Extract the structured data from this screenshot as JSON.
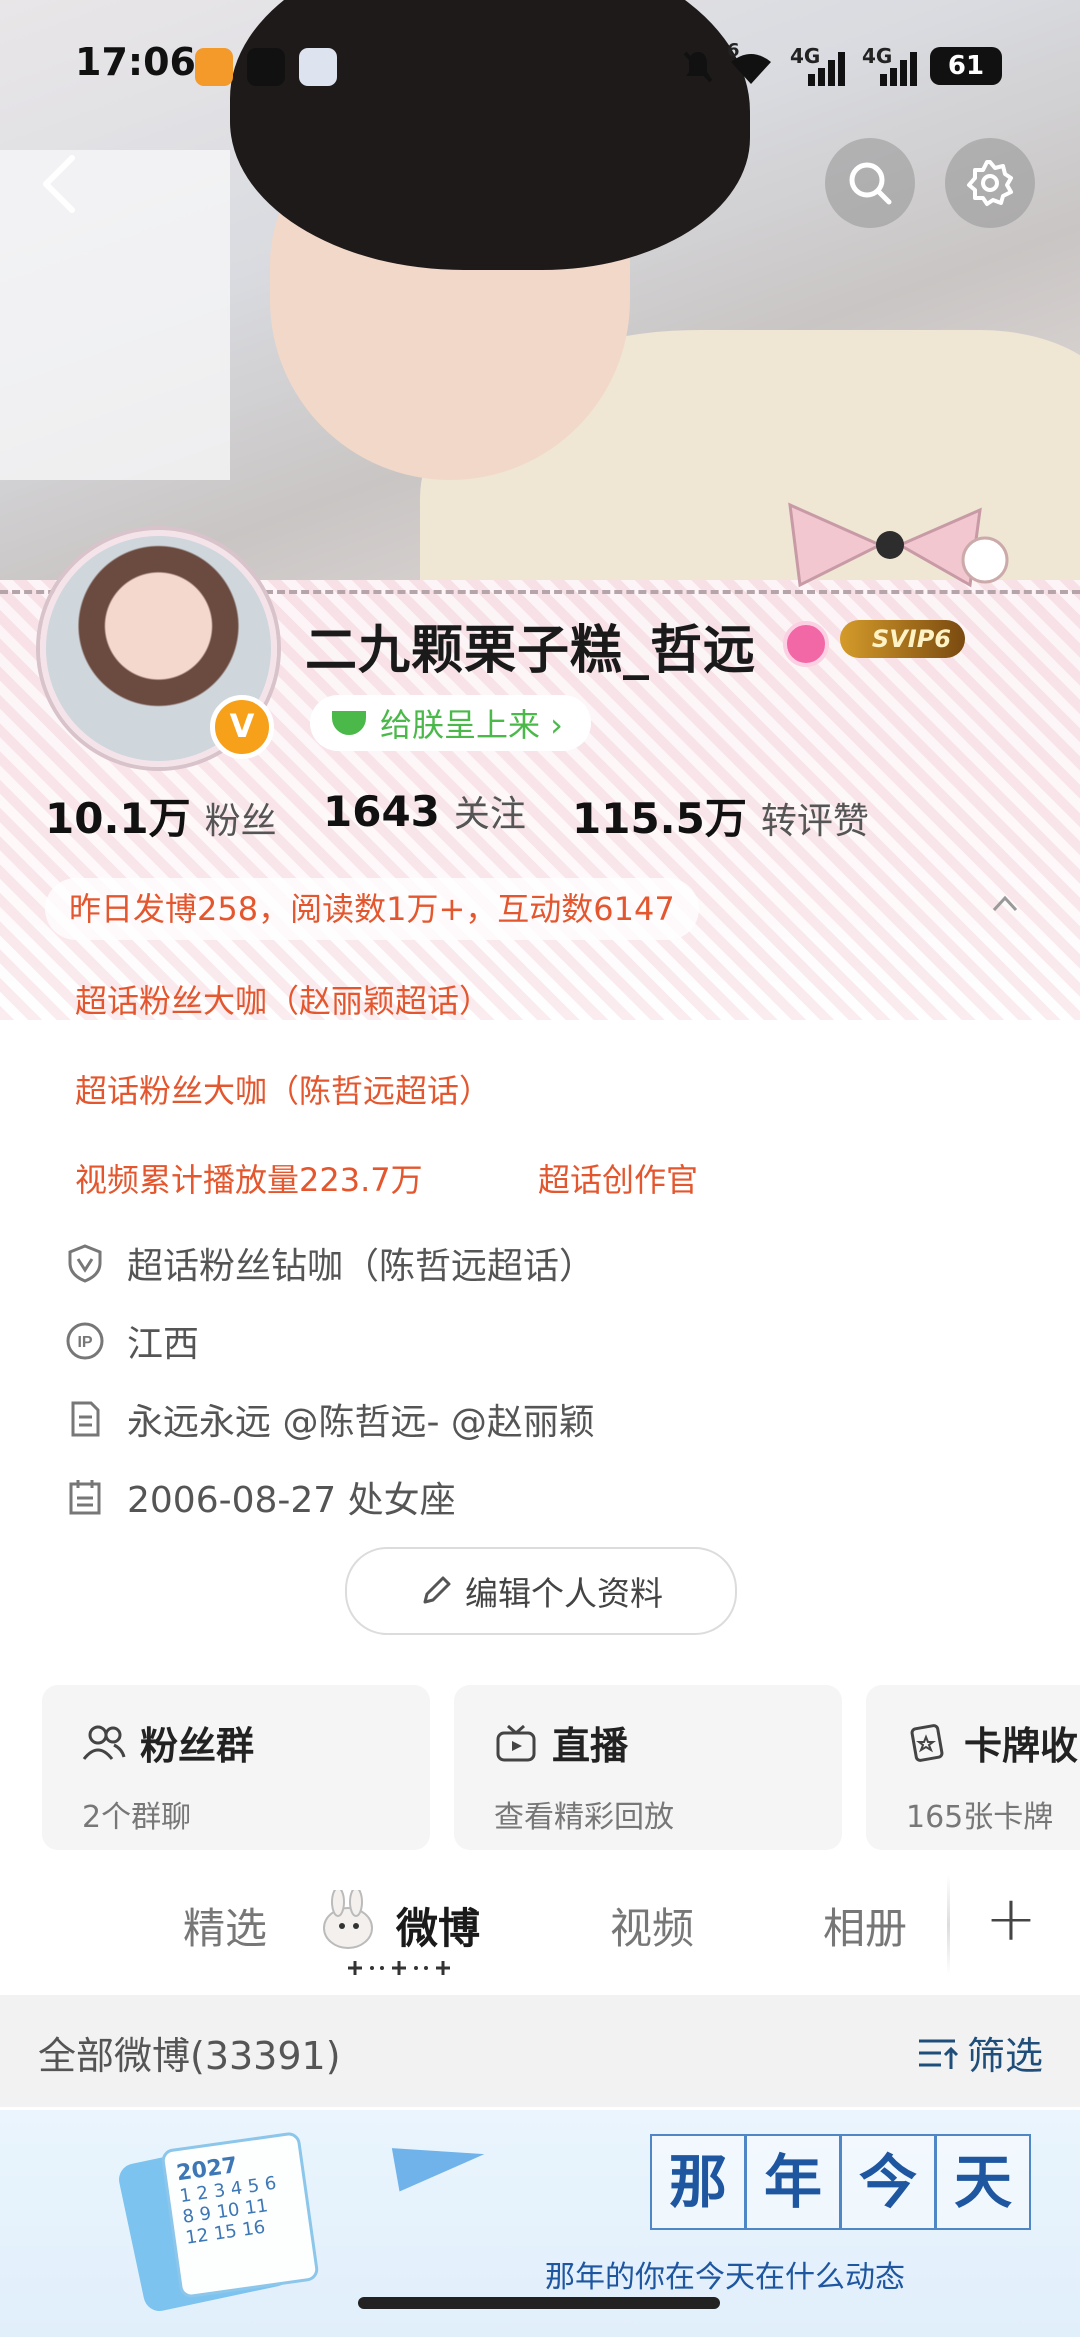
{
  "status_bar": {
    "time": "17:06",
    "battery": "61",
    "signal1": "4G",
    "signal2": "4G",
    "wifi_badge": "6"
  },
  "header": {
    "back_icon": "chevron-left-icon",
    "search_icon": "search-icon",
    "settings_icon": "gear-icon"
  },
  "profile": {
    "name": "二九颗栗子糕_哲远",
    "verified_badge": "V",
    "svip_label": "SVIP6",
    "gift_link": "给朕呈上来 ›",
    "stats": [
      {
        "value": "10.1万",
        "label": "粉丝"
      },
      {
        "value": "1643",
        "label": "关注"
      },
      {
        "value": "115.5万",
        "label": "转评赞"
      }
    ],
    "summary": "昨日发博258，阅读数1万+，互动数6147",
    "badges": [
      "超话粉丝大咖（赵丽颖超话）",
      "超话粉丝大咖（陈哲远超话）",
      "视频累计播放量223.7万",
      "超话创作官"
    ],
    "info": [
      {
        "icon": "shield-v-icon",
        "text": "超话粉丝钻咖（陈哲远超话）"
      },
      {
        "icon": "ip-icon",
        "text": "江西"
      },
      {
        "icon": "doc-icon",
        "text": "永远永远 @陈哲远- @赵丽颖"
      },
      {
        "icon": "calendar-icon",
        "text": "2006-08-27 处女座"
      }
    ],
    "edit_button": "编辑个人资料"
  },
  "cards": [
    {
      "title": "粉丝群",
      "sub": "2个群聊",
      "icon": "users-icon"
    },
    {
      "title": "直播",
      "sub": "查看精彩回放",
      "icon": "tv-icon"
    },
    {
      "title": "卡牌收",
      "sub": "165张卡牌",
      "icon": "card-icon"
    }
  ],
  "tabs": [
    {
      "label": "精选",
      "active": false
    },
    {
      "label": "微博",
      "active": true
    },
    {
      "label": "视频",
      "active": false
    },
    {
      "label": "相册",
      "active": false
    }
  ],
  "tab_add": "+",
  "feed": {
    "count_label": "全部微博(33391)",
    "filter_label": "筛选"
  },
  "banner": {
    "chars": [
      "那",
      "年",
      "今",
      "天"
    ],
    "subtitle": "那年的你在今天在什么动态",
    "calendar_year": "2027",
    "calendar_digits": "1 2 3 4 5 6 8 9 10 11 12 15 16"
  },
  "colors": {
    "accent_orange": "#e4572e",
    "weibo_link_blue": "#1f4e7a",
    "gift_green": "#4bb84a",
    "verified_orange": "#f7a019"
  }
}
